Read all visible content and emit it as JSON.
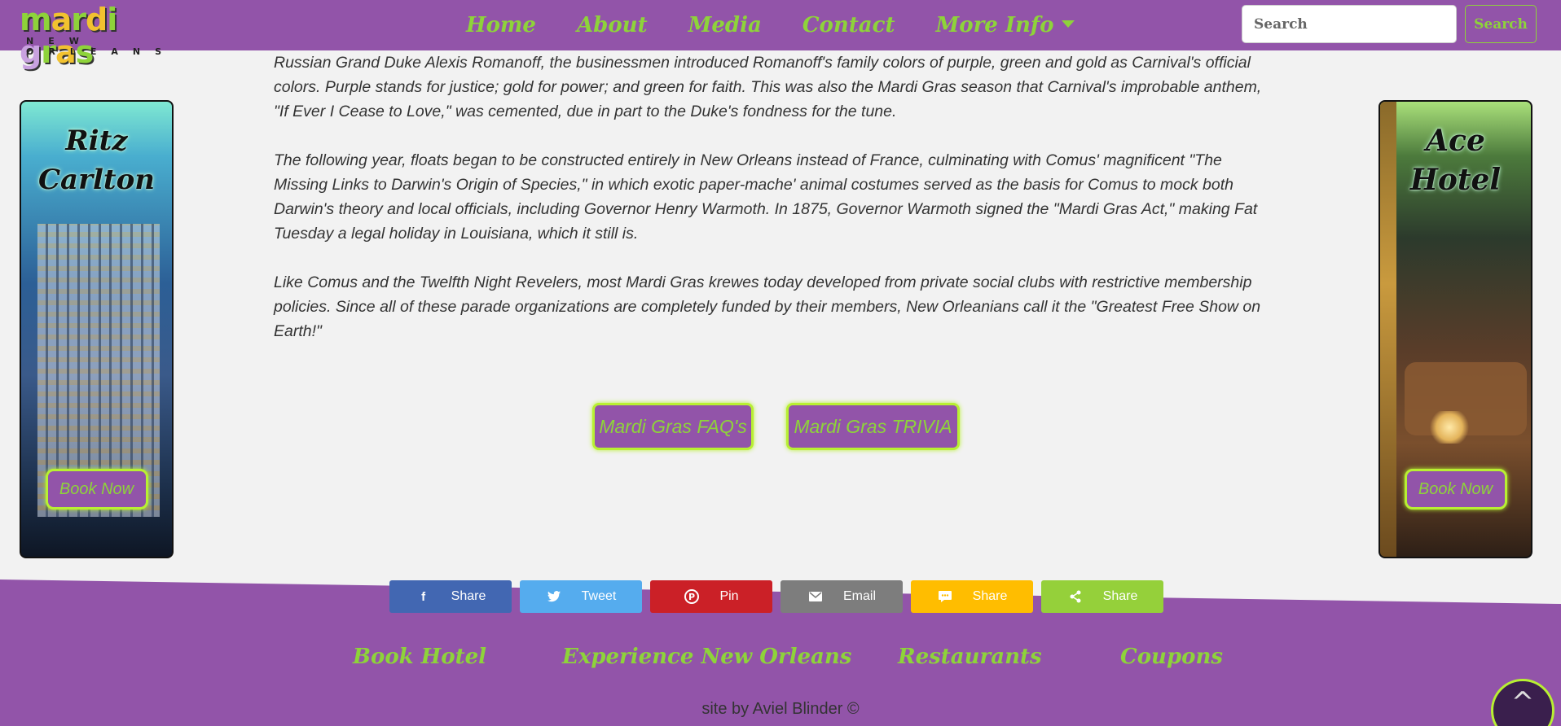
{
  "brand": {
    "logo_main": "mardi gras",
    "logo_sub": "NEW ORLEANS"
  },
  "nav": {
    "items": [
      "Home",
      "About",
      "Media",
      "Contact",
      "More Info"
    ],
    "search_placeholder": "Search",
    "search_button": "Search"
  },
  "ads": {
    "left": {
      "title_line1": "Ritz",
      "title_line2": "Carlton",
      "button": "Book Now"
    },
    "right": {
      "title": "Ace Hotel",
      "button": "Book Now"
    }
  },
  "article": {
    "paragraphs": [
      "Russian Grand Duke Alexis Romanoff, the businessmen introduced Romanoff's family colors of purple, green and gold as Carnival's official colors. Purple stands for justice; gold for power; and green for faith. This was also the Mardi Gras season that Carnival's improbable anthem, \"If Ever I Cease to Love,\" was cemented, due in part to the Duke's fondness for the tune.",
      "The following year, floats began to be constructed entirely in New Orleans instead of France, culminating with Comus' magnificent \"The Missing Links to Darwin's Origin of Species,\" in which exotic paper-mache' animal costumes served as the basis for Comus to mock both Darwin's theory and local officials, including Governor Henry Warmoth. In 1875, Governor Warmoth signed the \"Mardi Gras Act,\" making Fat Tuesday a legal holiday in Louisiana, which it still is.",
      "Like Comus and the Twelfth Night Revelers, most Mardi Gras krewes today developed from private social clubs with restrictive membership policies. Since all of these parade organizations are completely funded by their members, New Orleanians call it the \"Greatest Free Show on Earth!\""
    ]
  },
  "buttons": {
    "faq": "Mardi Gras FAQ's",
    "trivia": "Mardi Gras TRIVIA"
  },
  "share": [
    {
      "icon": "facebook-icon",
      "glyph": "f",
      "label": "Share",
      "color": "#4267b2"
    },
    {
      "icon": "twitter-icon",
      "glyph": "🐦",
      "label": "Tweet",
      "color": "#55acee"
    },
    {
      "icon": "pinterest-icon",
      "glyph": "P",
      "label": "Pin",
      "color": "#cb2027"
    },
    {
      "icon": "email-icon",
      "glyph": "✉",
      "label": "Email",
      "color": "#7d7d7d"
    },
    {
      "icon": "sms-icon",
      "glyph": "💬",
      "label": "Share",
      "color": "#ffbd00"
    },
    {
      "icon": "share-icon",
      "glyph": "<",
      "label": "Share",
      "color": "#95d03a"
    }
  ],
  "footer": {
    "links": [
      "Book Hotel",
      "Experience New Orleans",
      "Restaurants",
      "Coupons"
    ],
    "credit": "site by Aviel Blinder ©",
    "to_top": "^"
  },
  "colors": {
    "purple": "#9254a9",
    "green": "#8ed33a",
    "glow": "#b8f032"
  }
}
